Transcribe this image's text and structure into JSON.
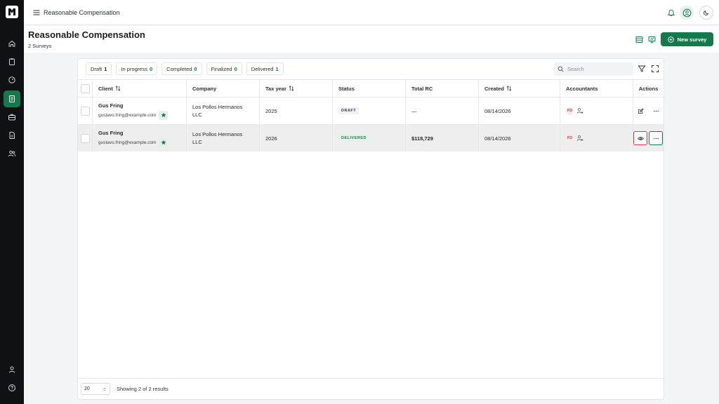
{
  "topbar": {
    "breadcrumb": "Reasonable Compensation"
  },
  "page": {
    "title": "Reasonable Compensation",
    "subtitle": "2 Surveys",
    "new_button": "New survey"
  },
  "filters": [
    {
      "label": "Draft",
      "count": "1"
    },
    {
      "label": "In progress",
      "count": "0"
    },
    {
      "label": "Completed",
      "count": "0"
    },
    {
      "label": "Finalized",
      "count": "0"
    },
    {
      "label": "Delivered",
      "count": "1"
    }
  ],
  "search": {
    "placeholder": "Search"
  },
  "table": {
    "headers": {
      "client": "Client",
      "company": "Company",
      "tax_year": "Tax year",
      "status": "Status",
      "total_rc": "Total RC",
      "created": "Created",
      "accountants": "Accountants",
      "actions": "Actions"
    },
    "rows": [
      {
        "client_name": "Gus Fring",
        "client_email": "gustavo.fring@example.com",
        "company_line1": "Los Pollos Hermanos",
        "company_line2": "LLC",
        "tax_year": "2025",
        "status": "DRAFT",
        "total_rc": "—",
        "created": "08/14/2026",
        "accountant_initials": "FO"
      },
      {
        "client_name": "Gus Fring",
        "client_email": "gustavo.fring@example.com",
        "company_line1": "Los Pollos Hermanos",
        "company_line2": "LLC",
        "tax_year": "2026",
        "status": "DELIVERED",
        "total_rc": "$118,729",
        "created": "08/14/2026",
        "accountant_initials": "FO"
      }
    ]
  },
  "footer": {
    "page_size": "20",
    "result_text": "Showing 2 of 2 results"
  },
  "colors": {
    "brand": "#157a4b",
    "rail": "#0f1113",
    "highlight_red": "#d63a3a"
  }
}
